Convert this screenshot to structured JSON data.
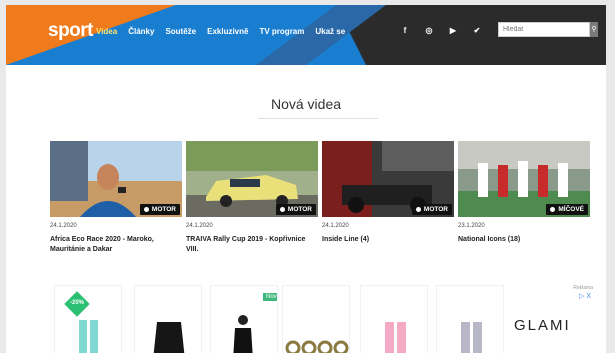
{
  "header": {
    "logo": "sport",
    "nav": [
      "Videa",
      "Články",
      "Soutěže",
      "Exkluzivně",
      "TV program",
      "Ukaž se"
    ],
    "active_nav": 0,
    "social_icons": [
      "facebook-icon",
      "instagram-icon",
      "youtube-icon",
      "twitter-icon",
      "rss-icon"
    ],
    "social_glyphs": [
      "f",
      "◎",
      "▶",
      "✔",
      "⌔"
    ],
    "search_placeholder": "Hledat",
    "search_icon_glyph": "⚲"
  },
  "section_title": "Nová videa",
  "videos": [
    {
      "date": "24.1.2020",
      "title": "Africa Eco Race 2020 - Maroko, Mauritánie a Dakar",
      "category": "MOTOR"
    },
    {
      "date": "24.1.2020",
      "title": "TRAIVA Rally Cup 2019 - Kopřivnice VIII.",
      "category": "MOTOR"
    },
    {
      "date": "24.1.2020",
      "title": "Inside Line (4)",
      "category": "MOTOR"
    },
    {
      "date": "23.1.2020",
      "title": "National Icons (18)",
      "category": "MÍČOVÉ"
    }
  ],
  "ads": {
    "discount": "-20%",
    "new_label": "Nový",
    "ad_label": "Reklama",
    "ad_close": "▷ X",
    "brand": "GLAMI"
  },
  "colors": {
    "orange": "#f07b1c",
    "blue": "#1a7ed0",
    "dark": "#2b2b2b"
  }
}
